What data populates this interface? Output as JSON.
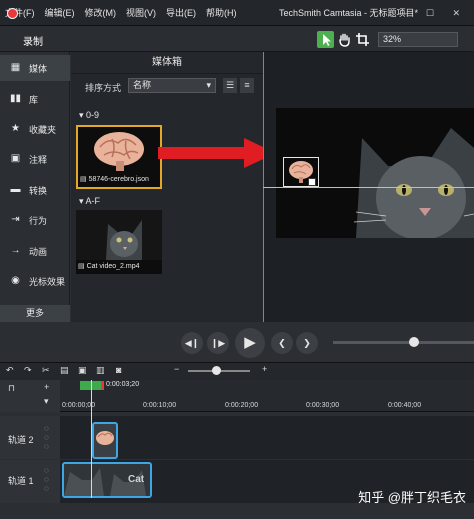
{
  "menubar": {
    "items": [
      "文件(F)",
      "编辑(E)",
      "修改(M)",
      "视图(V)",
      "导出(E)",
      "帮助(H)"
    ],
    "app_title": "TechSmith Camtasia - 无标题项目*",
    "window_controls": "— ☐ ✕"
  },
  "toolbar": {
    "record_label": "录制",
    "zoom": "32%",
    "accent": "#4caf50"
  },
  "sidebar": {
    "items": [
      {
        "label": "媒体",
        "icon": "film-icon"
      },
      {
        "label": "库",
        "icon": "library-icon"
      },
      {
        "label": "收藏夹",
        "icon": "star-icon"
      },
      {
        "label": "注释",
        "icon": "callout-icon"
      },
      {
        "label": "转换",
        "icon": "transition-icon"
      },
      {
        "label": "行为",
        "icon": "behavior-icon"
      },
      {
        "label": "动画",
        "icon": "animation-icon"
      },
      {
        "label": "光标效果",
        "icon": "cursor-icon"
      }
    ],
    "more_label": "更多"
  },
  "media_bin": {
    "title": "媒体箱",
    "sort_label": "排序方式",
    "sort_value": "名称",
    "groups": [
      {
        "name": "0-9",
        "file": "58746-cerebro.json"
      },
      {
        "name": "A-F",
        "file": "Cat video_2.mp4"
      }
    ]
  },
  "timeline": {
    "time_marker": "0:00:03;20",
    "ticks": [
      "0:00:00;00",
      "0:00:10;00",
      "0:00:20;00",
      "0:00:30;00",
      "0:00:40;00"
    ],
    "tracks": [
      {
        "label": "轨道 2"
      },
      {
        "label": "轨道 1"
      }
    ],
    "clip_text": "Cat"
  },
  "watermark": "知乎 @胖丁织毛衣"
}
